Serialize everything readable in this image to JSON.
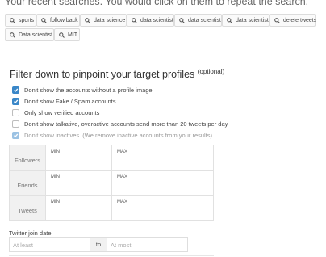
{
  "intro_text": "Your recent searches. You would click on them to repeat the search.",
  "recent_searches": [
    "sports",
    "follow back",
    "data science",
    "data scientist",
    "data scientist",
    "data scientist",
    "delete tweets",
    "Data scientist",
    "MIT"
  ],
  "filter": {
    "title": "Filter down to pinpoint your target profiles",
    "optional": "(optional)",
    "options": [
      {
        "label": "Don't show the accounts without a profile image",
        "checked": true,
        "disabled": false
      },
      {
        "label": "Don't show Fake / Spam accounts",
        "checked": true,
        "disabled": false
      },
      {
        "label": "Only show verified accounts",
        "checked": false,
        "disabled": false
      },
      {
        "label": "Don't show talkative, overactive accounts send more than 20 tweets per day",
        "checked": false,
        "disabled": false
      },
      {
        "label": "Don't show inactives. (We remove inactive accounts from your results)",
        "checked": true,
        "disabled": true
      }
    ]
  },
  "ranges": {
    "min_label": "MIN",
    "max_label": "MAX",
    "rows": [
      "Followers",
      "Friends",
      "Tweets"
    ]
  },
  "join_date": {
    "label": "Twitter join date",
    "from_placeholder": "At least",
    "separator": "to",
    "to_placeholder": "At most"
  },
  "colors": {
    "accent": "#3a87c8"
  }
}
